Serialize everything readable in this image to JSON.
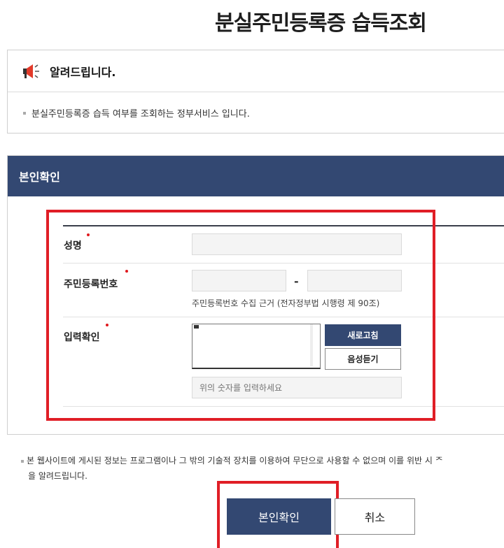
{
  "header": {
    "title": "분실주민등록증 습득조회"
  },
  "notice": {
    "title": "알려드립니다.",
    "text": "분실주민등록증 습득 여부를 조회하는 정부서비스 입니다."
  },
  "verify": {
    "title": "본인확인",
    "name_label": "성명",
    "rrn_label": "주민등록번호",
    "rrn_dash": "-",
    "rrn_hint": "주민등록번호 수집 근거 (전자정부법 시행령 제 90조)",
    "captcha_label": "입력확인",
    "refresh_label": "새로고침",
    "audio_label": "음성듣기",
    "captcha_placeholder": "위의 숫자를 입력하세요"
  },
  "disclaimer": {
    "line1": "본 웹사이트에 게시된 정보는 프로그램이나 그 밖의 기술적 장치를 이용하여 무단으로 사용할 수 없으며 이를 위반 시 ᄌ",
    "line2": "을 알려드립니다."
  },
  "actions": {
    "confirm_label": "본인확인",
    "cancel_label": "취소"
  },
  "colors": {
    "primary": "#334872",
    "required": "#e0191e",
    "highlight": "#e01e26"
  }
}
